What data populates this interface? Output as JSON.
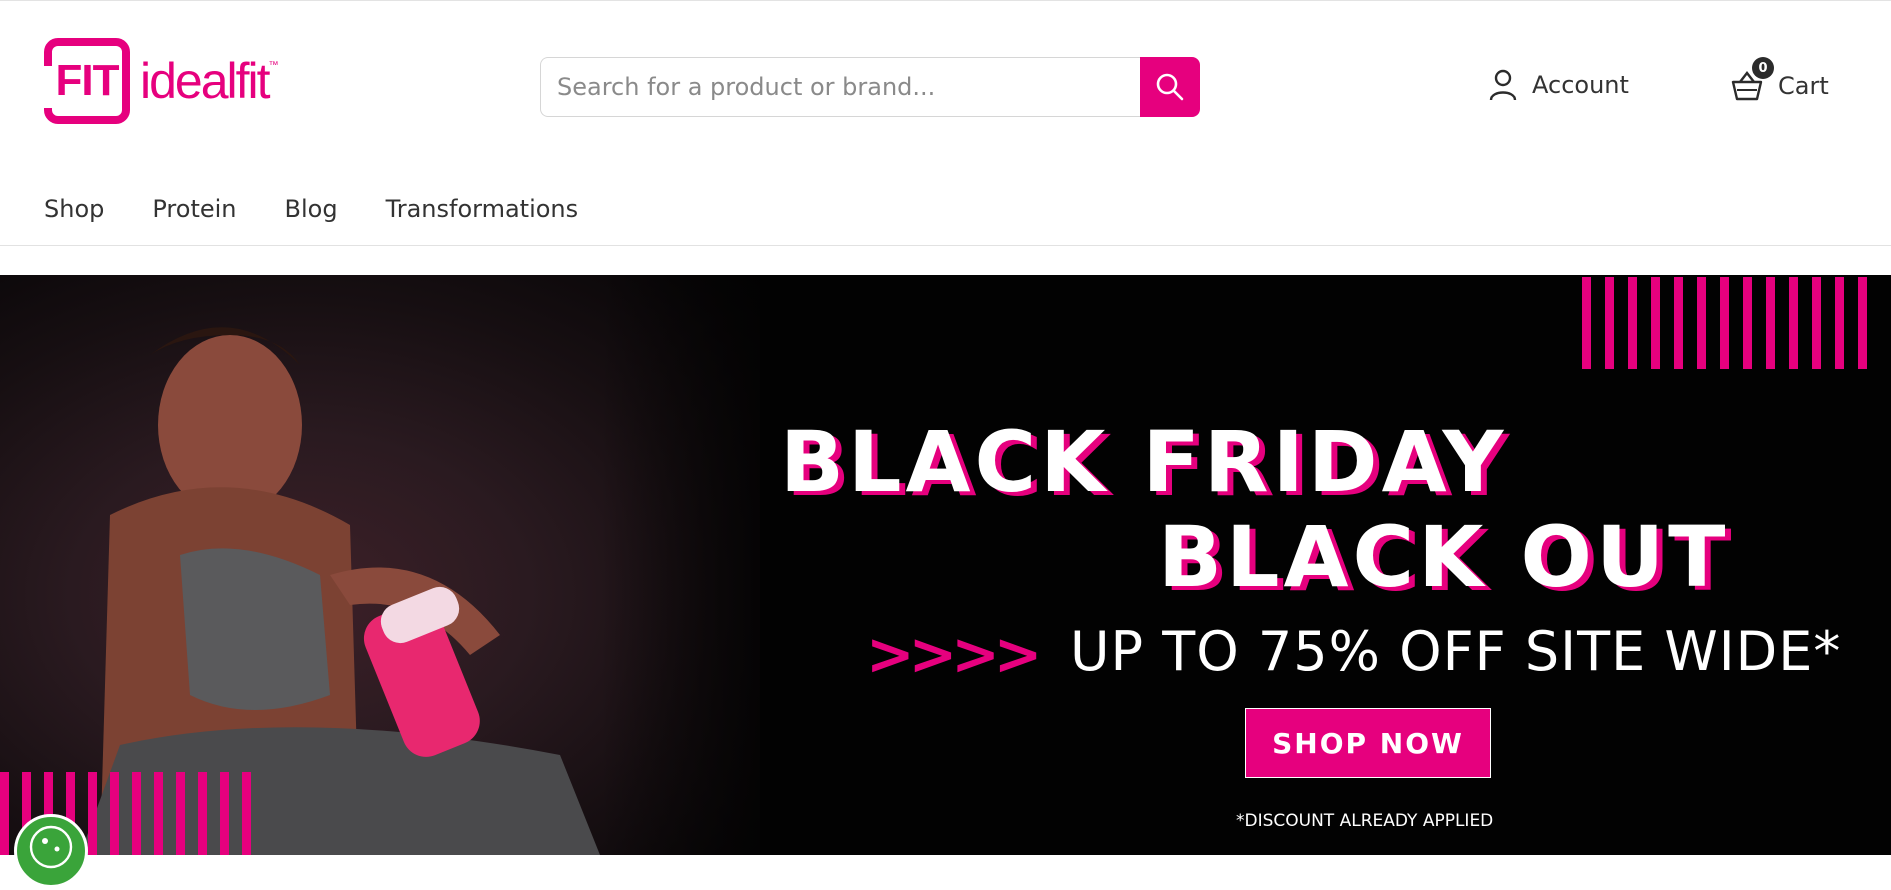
{
  "brand": {
    "logo_mark": "FIT",
    "logo_word": "idealfit",
    "trademark": "™",
    "accent": "#e6007e"
  },
  "search": {
    "placeholder": "Search for a product or brand..."
  },
  "account": {
    "label": "Account"
  },
  "cart": {
    "label": "Cart",
    "count": "0"
  },
  "nav": {
    "items": [
      {
        "label": "Shop"
      },
      {
        "label": "Protein"
      },
      {
        "label": "Blog"
      },
      {
        "label": "Transformations"
      }
    ]
  },
  "banner": {
    "headline_1": "BLACK FRIDAY",
    "headline_2": "BLACK OUT",
    "chevrons": ">>>>",
    "subheadline": "UP TO 75% OFF SITE WIDE*",
    "cta": "SHOP NOW",
    "disclaimer": "*DISCOUNT ALREADY APPLIED"
  },
  "icons": [
    "search-icon",
    "user-icon",
    "basket-icon",
    "cookie-icon"
  ]
}
